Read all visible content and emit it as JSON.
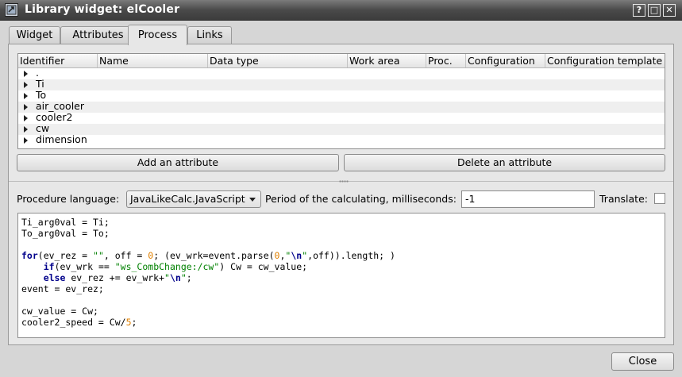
{
  "window": {
    "title": "Library widget: elCooler",
    "help_label": "?",
    "restore_label": "□",
    "close_label": "✕"
  },
  "tabs": [
    {
      "label": "Widget"
    },
    {
      "label": "Attributes"
    },
    {
      "label": "Process"
    },
    {
      "label": "Links"
    }
  ],
  "attributes_table": {
    "columns": [
      "Identifier",
      "Name",
      "Data type",
      "Work area",
      "Proc.",
      "Configuration",
      "Configuration template"
    ],
    "rows": [
      ".",
      "Ti",
      "To",
      "air_cooler",
      "cooler2",
      "cw",
      "dimension"
    ]
  },
  "buttons": {
    "add_attribute": "Add an attribute",
    "delete_attribute": "Delete an attribute",
    "close": "Close"
  },
  "procedure": {
    "language_label": "Procedure language:",
    "language_value": "JavaLikeCalc.JavaScript",
    "period_label": "Period of the calculating, milliseconds:",
    "period_value": "-1",
    "translate_label": "Translate:"
  },
  "code_lines": [
    "Ti_arg0val = Ti;",
    "To_arg0val = To;",
    "",
    "for(ev_rez = \"\", off = 0; (ev_wrk=event.parse(0,\"\\n\",off)).length; )",
    "    if(ev_wrk == \"ws_CombChange:/cw\") Cw = cw_value;",
    "    else ev_rez += ev_wrk+\"\\n\";",
    "event = ev_rez;",
    "",
    "cw_value = Cw;",
    "cooler2_speed = Cw/5;"
  ]
}
